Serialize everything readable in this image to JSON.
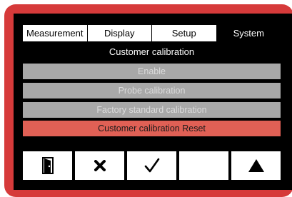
{
  "tabs": [
    "Measurement",
    "Display",
    "Setup",
    "System"
  ],
  "active_tab": "System",
  "section_title": "Customer calibration",
  "menu": [
    {
      "label": "Enable",
      "state": "disabled"
    },
    {
      "label": "Probe calibration",
      "state": "disabled"
    },
    {
      "label": "Factory standard calibration",
      "state": "disabled"
    },
    {
      "label": "Customer calibration Reset",
      "state": "selected"
    }
  ],
  "softkeys": [
    {
      "icon": "exit-door-icon"
    },
    {
      "icon": "cancel-x-icon"
    },
    {
      "icon": "checkmark-icon"
    },
    {
      "icon": "blank"
    },
    {
      "icon": "up-arrow-icon"
    }
  ],
  "colors": {
    "bezel": "#d63a3a",
    "screen": "#000000",
    "menu_disabled": "#a8a8a8",
    "menu_selected": "#e06055"
  }
}
